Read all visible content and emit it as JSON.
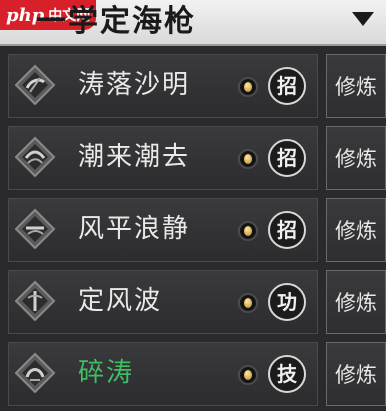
{
  "watermark": {
    "logo": "php",
    "text": "中文网"
  },
  "header": {
    "title": "一学定海枪"
  },
  "skills": [
    {
      "name": "涛落沙明",
      "type_badge": "招",
      "action_label": "修炼",
      "name_color": "#e9e9e9"
    },
    {
      "name": "潮来潮去",
      "type_badge": "招",
      "action_label": "修炼",
      "name_color": "#e9e9e9"
    },
    {
      "name": "风平浪静",
      "type_badge": "招",
      "action_label": "修炼",
      "name_color": "#e9e9e9"
    },
    {
      "name": "定风波",
      "type_badge": "功",
      "action_label": "修炼",
      "name_color": "#e9e9e9"
    },
    {
      "name": "碎涛",
      "type_badge": "技",
      "action_label": "修炼",
      "name_color": "#3fbf63"
    }
  ]
}
